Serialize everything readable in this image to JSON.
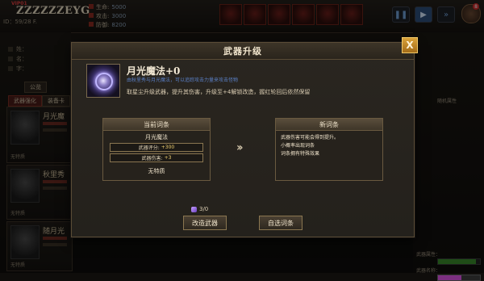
{
  "hud": {
    "player_tag": "VIP01",
    "player_name": "ZZZZZZEYG",
    "player_sub": "ID：59/28 F.",
    "stats": [
      {
        "label": "生命:",
        "value": "5000"
      },
      {
        "label": "攻击:",
        "value": "3000"
      },
      {
        "label": "防御:",
        "value": "8200"
      }
    ],
    "badge_count": "8"
  },
  "left": {
    "rows": [
      "姓：",
      "名：",
      "字："
    ],
    "tabs": [
      "公览",
      "武器强化",
      "装备卡"
    ],
    "cards": [
      {
        "title": "月光魔",
        "foot": "无特质"
      },
      {
        "title": "秋里秀",
        "foot": "无特质"
      },
      {
        "title": "随月光",
        "foot": "无特质"
      }
    ]
  },
  "right": {
    "label_1": "随机属性",
    "hp_label": "武器属性：",
    "mp_label": "武器名称："
  },
  "modal": {
    "title": "武器升级",
    "close_label": "X",
    "item_name": "月光魔法+0",
    "item_desc": "由秋里秀与月光魔法，可以追踪攻击力量来攻击怪物",
    "upgrade_text": "取星尘升级武器，提升其伤害，升级至+4解锁改造，握红轮回后依然保留",
    "current": {
      "header": "当前词条",
      "name": "月光魔法",
      "stats": [
        {
          "label": "武器评分:",
          "value": "+300"
        },
        {
          "label": "武器伤害:",
          "value": "+3"
        }
      ],
      "special": "无特质"
    },
    "arrow": "››",
    "new": {
      "header": "新词条",
      "lines": [
        "武器伤害可能会得到提升。",
        "小概率出现词条",
        "词条拥有特殊效果"
      ]
    },
    "cost": "3/0",
    "buttons": {
      "modify": "改造武器",
      "custom": "自选词条"
    }
  }
}
